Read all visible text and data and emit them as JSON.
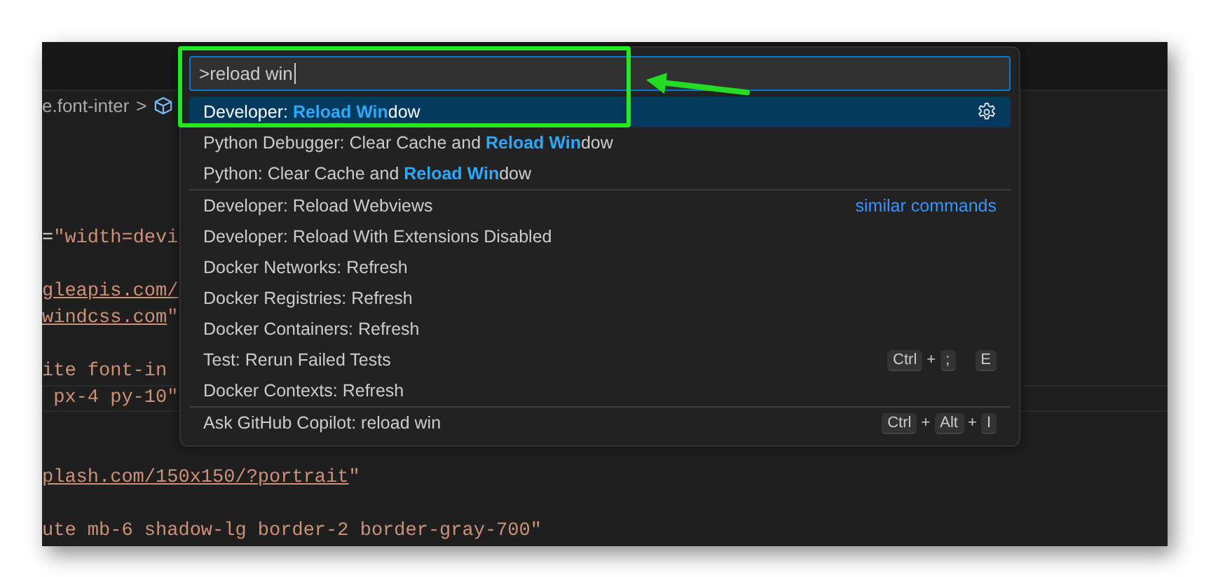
{
  "breadcrumb": {
    "text": "e.font-inter",
    "separator": ">"
  },
  "editor_lines": [
    {
      "kind": "blank"
    },
    {
      "kind": "blank"
    },
    {
      "kind": "blank"
    },
    {
      "kind": "blank"
    },
    {
      "kind": "code",
      "current": false,
      "segments": [
        {
          "kind": "plain",
          "text": "="
        },
        {
          "kind": "string",
          "text": "\"width=devi"
        }
      ]
    },
    {
      "kind": "blank"
    },
    {
      "kind": "code",
      "current": false,
      "segments": [
        {
          "kind": "link",
          "text": "gleapis.com/"
        }
      ]
    },
    {
      "kind": "code",
      "current": false,
      "segments": [
        {
          "kind": "link",
          "text": "windcss.com"
        },
        {
          "kind": "string",
          "text": "\""
        }
      ]
    },
    {
      "kind": "blank"
    },
    {
      "kind": "code",
      "current": false,
      "segments": [
        {
          "kind": "string",
          "text": "ite font-in"
        }
      ]
    },
    {
      "kind": "code",
      "current": true,
      "segments": [
        {
          "kind": "string",
          "text": " px-4 py-10\""
        }
      ]
    },
    {
      "kind": "blank"
    },
    {
      "kind": "blank"
    },
    {
      "kind": "code",
      "current": false,
      "segments": [
        {
          "kind": "link",
          "text": "plash.com/150x150/?portrait"
        },
        {
          "kind": "string",
          "text": "\""
        }
      ]
    },
    {
      "kind": "blank"
    },
    {
      "kind": "code",
      "current": false,
      "segments": [
        {
          "kind": "string",
          "text": "ute mb-6 shadow-lg border-2 border-gray-700\""
        }
      ]
    }
  ],
  "command_palette": {
    "query": ">reload win",
    "items": [
      {
        "label": "Developer: **Reload Win**dow",
        "selected": true,
        "separator": false
      },
      {
        "label": "Python Debugger: Clear Cache and **Reload Win**dow",
        "selected": false,
        "separator": false
      },
      {
        "label": "Python: Clear Cache and **Reload Win**dow",
        "selected": false,
        "separator": false
      },
      {
        "label": "Developer: Reload Webviews",
        "selected": false,
        "separator": true,
        "group_label": "similar commands"
      },
      {
        "label": "Developer: Reload With Extensions Disabled",
        "selected": false,
        "separator": false
      },
      {
        "label": "Docker Networks: Refresh",
        "selected": false,
        "separator": false
      },
      {
        "label": "Docker Registries: Refresh",
        "selected": false,
        "separator": false
      },
      {
        "label": "Docker Containers: Refresh",
        "selected": false,
        "separator": false
      },
      {
        "label": "Test: Rerun Failed Tests",
        "selected": false,
        "separator": false,
        "keybinding": [
          {
            "kind": "key",
            "text": "Ctrl"
          },
          {
            "kind": "plus",
            "text": "+"
          },
          {
            "kind": "key",
            "text": ";"
          },
          {
            "kind": "gap"
          },
          {
            "kind": "key",
            "text": "E"
          }
        ]
      },
      {
        "label": "Docker Contexts: Refresh",
        "selected": false,
        "separator": false
      },
      {
        "label": "Ask GitHub Copilot: reload win",
        "selected": false,
        "separator": true,
        "keybinding": [
          {
            "kind": "key",
            "text": "Ctrl"
          },
          {
            "kind": "plus",
            "text": "+"
          },
          {
            "kind": "key",
            "text": "Alt"
          },
          {
            "kind": "plus",
            "text": "+"
          },
          {
            "kind": "key",
            "text": "I"
          }
        ]
      }
    ]
  }
}
